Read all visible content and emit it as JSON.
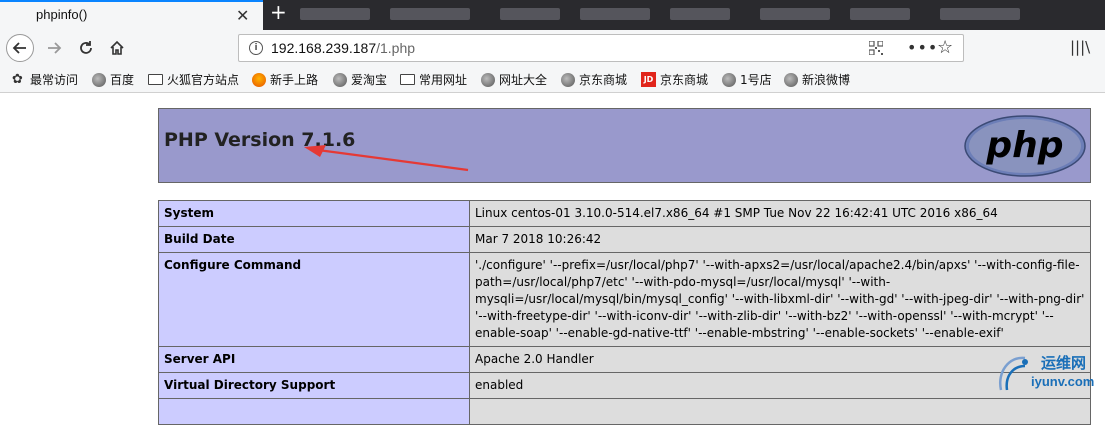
{
  "browser": {
    "tab_title": "phpinfo()",
    "tab_close": "✕",
    "new_tab": "+",
    "url_host": "192.168.239.187",
    "url_path": "/1.php"
  },
  "bookmarks": [
    {
      "label": "最常访问",
      "icon": "gear-icon"
    },
    {
      "label": "百度",
      "icon": "globe-icon"
    },
    {
      "label": "火狐官方站点",
      "icon": "folder-icon"
    },
    {
      "label": "新手上路",
      "icon": "firefox-icon"
    },
    {
      "label": "爱淘宝",
      "icon": "globe-icon"
    },
    {
      "label": "常用网址",
      "icon": "folder-icon"
    },
    {
      "label": "网址大全",
      "icon": "globe-icon"
    },
    {
      "label": "京东商城",
      "icon": "globe-icon"
    },
    {
      "label": "京东商城",
      "icon": "jd-icon"
    },
    {
      "label": "1号店",
      "icon": "globe-icon"
    },
    {
      "label": "新浪微博",
      "icon": "globe-icon"
    }
  ],
  "page": {
    "title": "PHP Version 7.1.6",
    "logo_text": "php",
    "rows": [
      {
        "key": "System",
        "value": "Linux centos-01 3.10.0-514.el7.x86_64 #1 SMP Tue Nov 22 16:42:41 UTC 2016 x86_64"
      },
      {
        "key": "Build Date",
        "value": "Mar 7 2018 10:26:42"
      },
      {
        "key": "Configure Command",
        "value": "'./configure' '--prefix=/usr/local/php7' '--with-apxs2=/usr/local/apache2.4/bin/apxs' '--with-config-file-path=/usr/local/php7/etc' '--with-pdo-mysql=/usr/local/mysql' '--with-mysqli=/usr/local/mysql/bin/mysql_config' '--with-libxml-dir' '--with-gd' '--with-jpeg-dir' '--with-png-dir' '--with-freetype-dir' '--with-iconv-dir' '--with-zlib-dir' '--with-bz2' '--with-openssl' '--with-mcrypt' '--enable-soap' '--enable-gd-native-ttf' '--enable-mbstring' '--enable-sockets' '--enable-exif'"
      },
      {
        "key": "Server API",
        "value": "Apache 2.0 Handler"
      },
      {
        "key": "Virtual Directory Support",
        "value": "enabled"
      },
      {
        "key": "",
        "value": ""
      }
    ]
  },
  "watermark": {
    "line1": "运维网",
    "line2": "iyunv.com"
  },
  "colors": {
    "header_bg": "#9999cc",
    "key_bg": "#ccccff",
    "value_bg": "#dddddd",
    "arrow": "#e53935"
  }
}
